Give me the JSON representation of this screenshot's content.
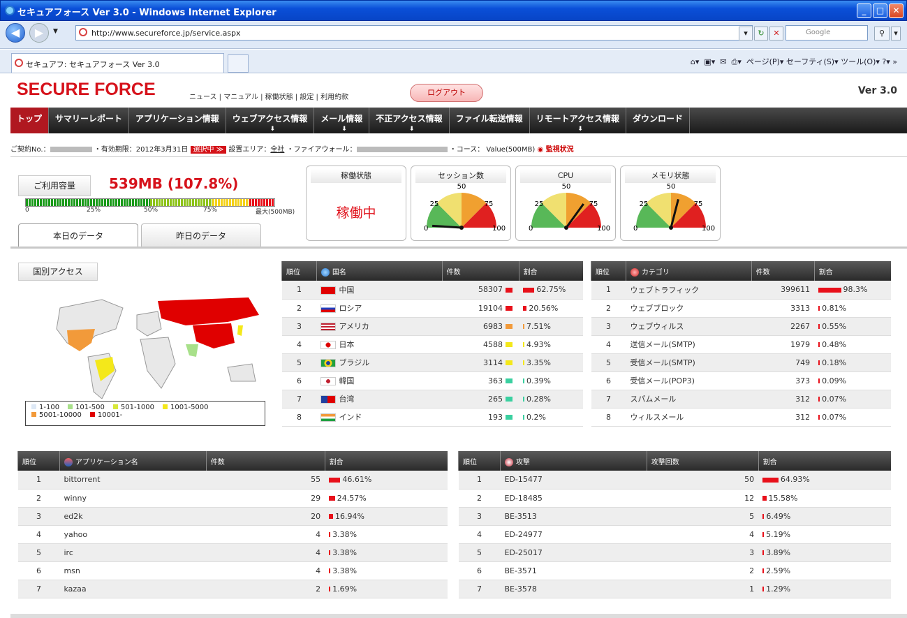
{
  "window": {
    "title": "セキュアフォース Ver 3.0 - Windows Internet Explorer"
  },
  "browser": {
    "url": "http://www.secureforce.jp/service.aspx",
    "search_placeholder": "Google",
    "tab_label": "セキュアフ: セキュアフォース Ver 3.0",
    "commands": "ページ(P)▾  セーフティ(S)▾  ツール(O)▾"
  },
  "header": {
    "logo": "SECURE FORCE",
    "links": "ニュース | マニュアル | 稼働状態 | 設定 | 利用約款",
    "logout": "ログアウト",
    "version": "Ver 3.0"
  },
  "nav": [
    {
      "label": "トップ",
      "active": true,
      "arrow": false
    },
    {
      "label": "サマリーレポート",
      "arrow": false
    },
    {
      "label": "アプリケーション情報",
      "arrow": false
    },
    {
      "label": "ウェブアクセス情報",
      "arrow": true
    },
    {
      "label": "メール情報",
      "arrow": true
    },
    {
      "label": "不正アクセス情報",
      "arrow": true
    },
    {
      "label": "ファイル転送情報",
      "arrow": false
    },
    {
      "label": "リモートアクセス情報",
      "arrow": true
    },
    {
      "label": "ダウンロード",
      "arrow": false
    }
  ],
  "contract": {
    "no_label": "ご契約No.：",
    "expiry": "・有効期限：2012年3月31日",
    "selecting": "選択中 ≫",
    "area_label": "設置エリア：",
    "area": "全社",
    "firewall_label": "・ファイアウォール：",
    "course": "・コース： Value(500MB)",
    "monitor": "監視状況"
  },
  "usage": {
    "label": "ご利用容量",
    "value": "539MB (107.8%)",
    "ticks": [
      "0",
      "25%",
      "50%",
      "75%",
      "最大(500MB)"
    ],
    "percent": 107.8
  },
  "day_tabs": {
    "today": "本日のデータ",
    "yesterday": "昨日のデータ"
  },
  "panels": {
    "status_title": "稼働状態",
    "status_value": "稼働中",
    "session_title": "セッション数",
    "cpu_title": "CPU",
    "memory_title": "メモリ状態",
    "gauge_labels": [
      "0",
      "25",
      "50",
      "75",
      "100"
    ]
  },
  "gauge_values": {
    "session": 2,
    "cpu": 70,
    "memory": 58
  },
  "country": {
    "button": "国別アクセス",
    "legend": [
      "1-100",
      "101-500",
      "501-1000",
      "1001-5000",
      "5001-10000",
      "10001-"
    ],
    "legend_colors": [
      "#dde8f5",
      "#a8e08a",
      "#d8e83a",
      "#f4e81a",
      "#f29a3a",
      "#e00000"
    ],
    "headers": [
      "順位",
      "国名",
      "件数",
      "割合"
    ],
    "rows": [
      {
        "rank": "1",
        "name": "中国",
        "count": "58307",
        "pct": "62.75%",
        "v": 62.75,
        "color": "#e8101a"
      },
      {
        "rank": "2",
        "name": "ロシア",
        "count": "19104",
        "pct": "20.56%",
        "v": 20.56,
        "color": "#e8101a"
      },
      {
        "rank": "3",
        "name": "アメリカ",
        "count": "6983",
        "pct": "7.51%",
        "v": 7.51,
        "color": "#f29a3a"
      },
      {
        "rank": "4",
        "name": "日本",
        "count": "4588",
        "pct": "4.93%",
        "v": 4.93,
        "color": "#f4e81a"
      },
      {
        "rank": "5",
        "name": "ブラジル",
        "count": "3114",
        "pct": "3.35%",
        "v": 3.35,
        "color": "#f4e81a"
      },
      {
        "rank": "6",
        "name": "韓国",
        "count": "363",
        "pct": "0.39%",
        "v": 0.39,
        "color": "#3ad0a0"
      },
      {
        "rank": "7",
        "name": "台湾",
        "count": "265",
        "pct": "0.28%",
        "v": 0.28,
        "color": "#3ad0a0"
      },
      {
        "rank": "8",
        "name": "インド",
        "count": "193",
        "pct": "0.2%",
        "v": 0.2,
        "color": "#3ad0a0"
      }
    ]
  },
  "category": {
    "headers": [
      "順位",
      "カテゴリ",
      "件数",
      "割合"
    ],
    "rows": [
      {
        "rank": "1",
        "name": "ウェブトラフィック",
        "count": "399611",
        "pct": "98.3%",
        "v": 98.3
      },
      {
        "rank": "2",
        "name": "ウェブブロック",
        "count": "3313",
        "pct": "0.81%",
        "v": 0.81
      },
      {
        "rank": "3",
        "name": "ウェブウィルス",
        "count": "2267",
        "pct": "0.55%",
        "v": 0.55
      },
      {
        "rank": "4",
        "name": "送信メール(SMTP)",
        "count": "1979",
        "pct": "0.48%",
        "v": 0.48
      },
      {
        "rank": "5",
        "name": "受信メール(SMTP)",
        "count": "749",
        "pct": "0.18%",
        "v": 0.18
      },
      {
        "rank": "6",
        "name": "受信メール(POP3)",
        "count": "373",
        "pct": "0.09%",
        "v": 0.09
      },
      {
        "rank": "7",
        "name": "スパムメール",
        "count": "312",
        "pct": "0.07%",
        "v": 0.07
      },
      {
        "rank": "8",
        "name": "ウィルスメール",
        "count": "312",
        "pct": "0.07%",
        "v": 0.07
      }
    ]
  },
  "apps": {
    "headers": [
      "順位",
      "アプリケーション名",
      "件数",
      "割合"
    ],
    "rows": [
      {
        "rank": "1",
        "name": "bittorrent",
        "count": "55",
        "pct": "46.61%",
        "v": 46.61
      },
      {
        "rank": "2",
        "name": "winny",
        "count": "29",
        "pct": "24.57%",
        "v": 24.57
      },
      {
        "rank": "3",
        "name": "ed2k",
        "count": "20",
        "pct": "16.94%",
        "v": 16.94
      },
      {
        "rank": "4",
        "name": "yahoo",
        "count": "4",
        "pct": "3.38%",
        "v": 3.38
      },
      {
        "rank": "5",
        "name": "irc",
        "count": "4",
        "pct": "3.38%",
        "v": 3.38
      },
      {
        "rank": "6",
        "name": "msn",
        "count": "4",
        "pct": "3.38%",
        "v": 3.38
      },
      {
        "rank": "7",
        "name": "kazaa",
        "count": "2",
        "pct": "1.69%",
        "v": 1.69
      }
    ]
  },
  "attacks": {
    "headers": [
      "順位",
      "攻撃",
      "攻撃回数",
      "割合"
    ],
    "rows": [
      {
        "rank": "1",
        "name": "ED-15477",
        "count": "50",
        "pct": "64.93%",
        "v": 64.93
      },
      {
        "rank": "2",
        "name": "ED-18485",
        "count": "12",
        "pct": "15.58%",
        "v": 15.58
      },
      {
        "rank": "3",
        "name": "BE-3513",
        "count": "5",
        "pct": "6.49%",
        "v": 6.49
      },
      {
        "rank": "4",
        "name": "ED-24977",
        "count": "4",
        "pct": "5.19%",
        "v": 5.19
      },
      {
        "rank": "5",
        "name": "ED-25017",
        "count": "3",
        "pct": "3.89%",
        "v": 3.89
      },
      {
        "rank": "6",
        "name": "BE-3571",
        "count": "2",
        "pct": "2.59%",
        "v": 2.59
      },
      {
        "rank": "7",
        "name": "BE-3578",
        "count": "1",
        "pct": "1.29%",
        "v": 1.29
      }
    ]
  },
  "colors": {
    "brand": "#d6121b",
    "bar": "#e8101a"
  }
}
